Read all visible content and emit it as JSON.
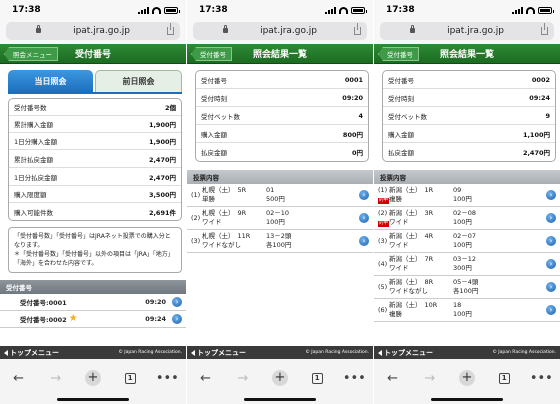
{
  "browser": {
    "url": "ipat.jra.go.jp",
    "tab_count": "1"
  },
  "footer": {
    "top_menu_label": "トップメニュー",
    "copyright": "© Japan Racing Association."
  },
  "screen1": {
    "time": "17:38",
    "back_label": "照会メニュー",
    "title": "受付番号",
    "tabs": [
      "当日照会",
      "前日照会"
    ],
    "summary": [
      {
        "label": "受付番号数",
        "value": "2個"
      },
      {
        "label": "累計購入金額",
        "value": "1,900円"
      },
      {
        "label": "1日分購入金額",
        "value": "1,900円"
      },
      {
        "label": "累計払戻金額",
        "value": "2,470円"
      },
      {
        "label": "1日分払戻金額",
        "value": "2,470円"
      },
      {
        "label": "購入限度額",
        "value": "3,500円"
      },
      {
        "label": "購入可能件数",
        "value": "2,691件"
      }
    ],
    "note_line1": "「受付番号数」「受付番号」はJRAネット投票での購入分となります。",
    "note_line2": "＊「受付番号数」「受付番号」以外の項目は「JRA」「地方」「海外」を合わせた内容です。",
    "section_label": "受付番号",
    "receipts": [
      {
        "label": "受付番号:0001",
        "time": "09:20"
      },
      {
        "label": "受付番号:0002",
        "time": "09:24"
      }
    ]
  },
  "screen2": {
    "time": "17:38",
    "back_label": "受付番号",
    "title": "照会結果一覧",
    "summary": [
      {
        "label": "受付番号",
        "value": "0001"
      },
      {
        "label": "受付時刻",
        "value": "09:20"
      },
      {
        "label": "受付ベット数",
        "value": "4"
      },
      {
        "label": "購入金額",
        "value": "800円"
      },
      {
        "label": "払戻金額",
        "value": "0円"
      }
    ],
    "section_label": "投票内容",
    "bets": [
      {
        "idx": "(1)",
        "course": "札幌（土）",
        "race": "5R",
        "type": "単勝",
        "pick": "01",
        "amount": "500円",
        "mark": ""
      },
      {
        "idx": "(2)",
        "course": "札幌（土）",
        "race": "9R",
        "type": "ワイド",
        "pick": "02－10",
        "amount": "100円",
        "mark": ""
      },
      {
        "idx": "(3)",
        "course": "札幌（土）",
        "race": "11R",
        "type": "ワイドながし",
        "pick": "13－2頭",
        "amount": "各100円",
        "mark": ""
      }
    ]
  },
  "screen3": {
    "time": "17:38",
    "back_label": "受付番号",
    "title": "照会結果一覧",
    "summary": [
      {
        "label": "受付番号",
        "value": "0002"
      },
      {
        "label": "受付時刻",
        "value": "09:24"
      },
      {
        "label": "受付ベット数",
        "value": "9"
      },
      {
        "label": "購入金額",
        "value": "1,100円"
      },
      {
        "label": "払戻金額",
        "value": "2,470円"
      }
    ],
    "section_label": "投票内容",
    "bets": [
      {
        "idx": "(1)",
        "course": "新潟（土）",
        "race": "1R",
        "type": "複勝",
        "pick": "09",
        "amount": "100円",
        "mark": "的中"
      },
      {
        "idx": "(2)",
        "course": "新潟（土）",
        "race": "3R",
        "type": "ワイド",
        "pick": "02－08",
        "amount": "100円",
        "mark": "的中"
      },
      {
        "idx": "(3)",
        "course": "新潟（土）",
        "race": "4R",
        "type": "ワイド",
        "pick": "02－07",
        "amount": "100円",
        "mark": ""
      },
      {
        "idx": "(4)",
        "course": "新潟（土）",
        "race": "7R",
        "type": "ワイド",
        "pick": "03－12",
        "amount": "300円",
        "mark": ""
      },
      {
        "idx": "(5)",
        "course": "新潟（土）",
        "race": "8R",
        "type": "ワイドながし",
        "pick": "05－4頭",
        "amount": "各100円",
        "mark": ""
      },
      {
        "idx": "(6)",
        "course": "新潟（土）",
        "race": "10R",
        "type": "複勝",
        "pick": "18",
        "amount": "100円",
        "mark": ""
      }
    ]
  }
}
